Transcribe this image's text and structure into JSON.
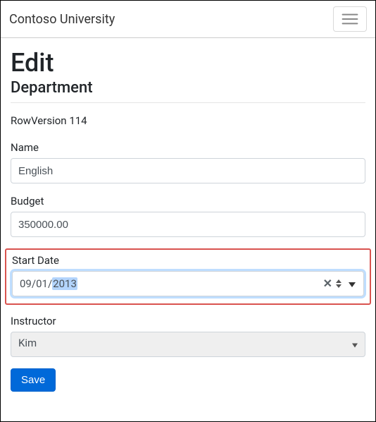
{
  "navbar": {
    "brand": "Contoso University"
  },
  "page": {
    "title": "Edit",
    "subtitle": "Department"
  },
  "rowversion": {
    "label": "RowVersion",
    "value": "114"
  },
  "form": {
    "name": {
      "label": "Name",
      "value": "English"
    },
    "budget": {
      "label": "Budget",
      "value": "350000.00"
    },
    "startdate": {
      "label": "Start Date",
      "month": "09",
      "day": "01",
      "year": "2013"
    },
    "instructor": {
      "label": "Instructor",
      "value": "Kim"
    },
    "save_label": "Save"
  }
}
